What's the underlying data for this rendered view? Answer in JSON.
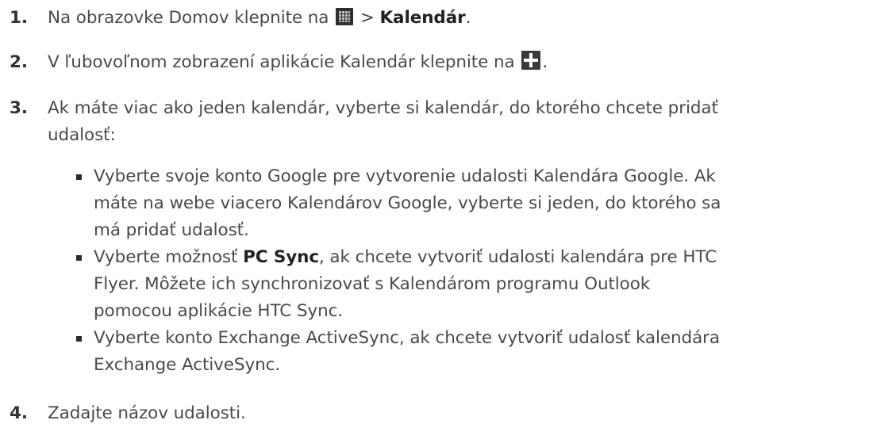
{
  "steps": [
    {
      "number": "1.",
      "before": "Na obrazovke Domov klepnite na ",
      "icon": "apps-grid-icon",
      "middle": " > ",
      "highlight": "Kalendár",
      "after": "."
    },
    {
      "number": "2.",
      "before": "V ľubovoľnom zobrazení aplikácie Kalendár klepnite na ",
      "icon": "add-plus-icon",
      "after": "."
    },
    {
      "number": "3.",
      "lines": [
        "Ak máte viac ako jeden kalendár, vyberte si kalendár, do ktorého chcete pridať",
        "udalosť:"
      ]
    },
    {
      "number": "4.",
      "text": "Zadajte názov udalosti."
    }
  ],
  "bullets": [
    {
      "lines": [
        "Vyberte svoje konto Google pre vytvorenie udalosti Kalendára Google. Ak",
        "máte na webe viacero Kalendárov Google, vyberte si jeden, do ktorého sa",
        "má pridať udalosť."
      ]
    },
    {
      "line1_before": "Vyberte možnosť ",
      "line1_highlight": "PC Sync",
      "line1_after": ", ak chcete vytvoriť udalosti kalendára pre HTC",
      "lines": [
        "Flyer. Môžete ich synchronizovať s Kalendárom programu Outlook",
        "pomocou aplikácie HTC Sync."
      ]
    },
    {
      "lines": [
        "Vyberte konto Exchange ActiveSync, ak chcete vytvoriť udalosť kalendára",
        "Exchange ActiveSync."
      ]
    }
  ],
  "colors": {
    "text": "#4a4a4a",
    "highlight": "#222222",
    "icon_dark": "#2e2e2e",
    "icon_plus_bg": "#3a3a3a"
  }
}
